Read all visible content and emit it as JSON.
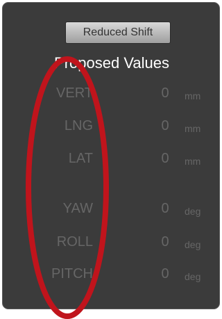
{
  "toolbar": {
    "shift_button_label": "Reduced Shift"
  },
  "section_title": "Proposed Values",
  "fields": [
    {
      "label": "VERT",
      "value": "0",
      "unit": "mm"
    },
    {
      "label": "LNG",
      "value": "0",
      "unit": "mm"
    },
    {
      "label": "LAT",
      "value": "0",
      "unit": "mm"
    },
    {
      "label": "YAW",
      "value": "0",
      "unit": "deg"
    },
    {
      "label": "ROLL",
      "value": "0",
      "unit": "deg"
    },
    {
      "label": "PITCH",
      "value": "0",
      "unit": "deg"
    }
  ],
  "colors": {
    "panel_background": "#3b3b3b",
    "dimmed_text": "#666666",
    "title_text": "#ffffff",
    "annotation_ellipse": "#c0141c"
  }
}
